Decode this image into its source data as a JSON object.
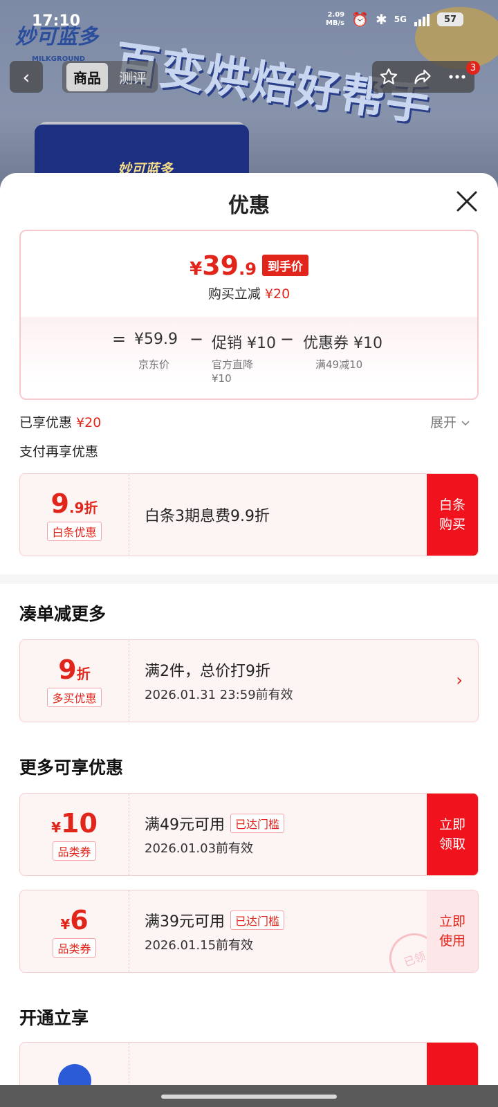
{
  "status_bar": {
    "time": "17:10",
    "net_speed_value": "2.09",
    "net_speed_unit": "MB/s",
    "network": "5G",
    "battery": "57"
  },
  "background": {
    "brand_logo": "妙可蓝多",
    "brand_sub": "MILKGROUND",
    "banner": "百变烘焙好帮手",
    "can_logo": "妙可蓝多"
  },
  "nav": {
    "tabs": [
      "商品",
      "测评"
    ],
    "badge": "3"
  },
  "sheet": {
    "title": "优惠",
    "price_card": {
      "currency": "¥",
      "price_int": "39",
      "price_dec": ".9",
      "price_tag": "到手价",
      "subtitle_prefix": "购买立减",
      "subtitle_amount": "¥20",
      "breakdown": {
        "equals": "=",
        "minus": "−",
        "jd_price": "¥59.9",
        "jd_label": "京东价",
        "promo": "促销 ¥10",
        "promo_label_1": "官方直降",
        "promo_label_2": "¥10",
        "coupon": "优惠券 ¥10",
        "coupon_label": "满49减10"
      }
    },
    "enjoyed_prefix": "已享优惠",
    "enjoyed_amount": "¥20",
    "expand_label": "展开",
    "pay_more_label": "支付再享优惠",
    "baitiao_coupon": {
      "value_big": "9",
      "value_small": ".9折",
      "chip": "白条优惠",
      "text": "白条3期息费9.9折",
      "action": "白条购买"
    },
    "bundle_section_title": "凑单减更多",
    "bundle_coupon": {
      "value_big": "9",
      "value_small": "折",
      "chip": "多买优惠",
      "line1": "满2件，总价打9折",
      "line2": "2026.01.31 23:59前有效"
    },
    "more_section_title": "更多可享优惠",
    "coupons": [
      {
        "currency": "¥",
        "value": "10",
        "chip": "品类券",
        "line1": "满49元可用",
        "reached": "已达门槛",
        "line2": "2026.01.03前有效",
        "action": "立即领取"
      },
      {
        "currency": "¥",
        "value": "6",
        "chip": "品类券",
        "line1": "满39元可用",
        "reached": "已达门槛",
        "line2": "2026.01.15前有效",
        "action": "立即使用",
        "stamp": "已领"
      }
    ],
    "open_section_title": "开通立享"
  },
  "colors": {
    "accent_red": "#e1251b",
    "button_red": "#f0131e",
    "card_bg": "#fdf4f4"
  }
}
